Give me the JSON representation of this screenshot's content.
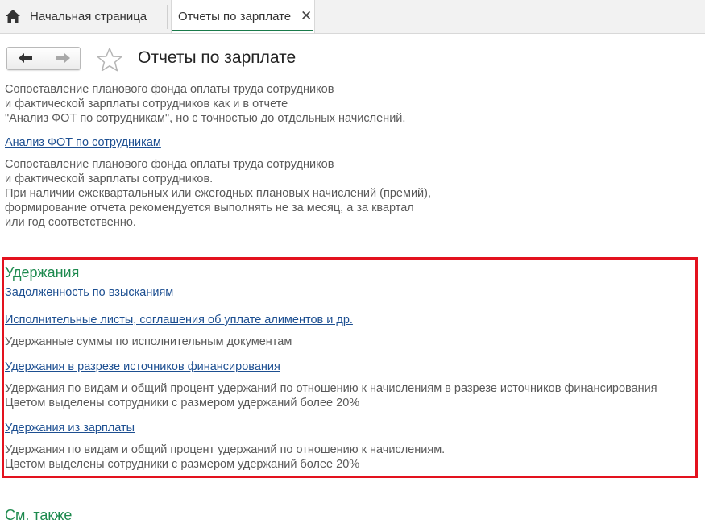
{
  "tabs": {
    "home_label": "Начальная страница",
    "active_label": "Отчеты по зарплате",
    "close_glyph": "✕"
  },
  "header": {
    "title": "Отчеты по зарплате"
  },
  "top_section": {
    "cut_line_1": "Сопоставление планового фонда оплаты труда сотрудников",
    "line_2": "и фактической зарплаты сотрудников как и в отчете",
    "line_3": "\"Анализ ФОТ по сотрудникам\", но с точностью до отдельных начислений.",
    "link_fot": "Анализ ФОТ по сотрудникам",
    "fot_desc": [
      "Сопоставление планового фонда оплаты труда сотрудников",
      "и фактической зарплаты сотрудников.",
      "При наличии ежеквартальных или ежегодных плановых начислений (премий),",
      "формирование отчета рекомендуется выполнять не за месяц, а за квартал",
      "или год соответственно."
    ]
  },
  "withholdings": {
    "title": "Удержания",
    "link_debt": "Задолженность по взысканиям",
    "link_writs": "Исполнительные листы, соглашения об уплате алиментов и др.",
    "writs_desc": "Удержанные суммы по исполнительным документам",
    "link_sources": "Удержания в разрезе источников финансирования",
    "sources_desc": [
      "Удержания по видам и общий процент удержаний по отношению к начислениям в разрезе источников финансирования",
      "Цветом выделены сотрудники с размером удержаний более 20%"
    ],
    "link_salary": "Удержания из зарплаты",
    "salary_desc": [
      "Удержания по видам и общий процент удержаний по отношению к начислениям.",
      "Цветом выделены сотрудники с размером удержаний более 20%"
    ]
  },
  "see_also": {
    "title": "См. также"
  },
  "colors": {
    "section_title": "#1d8a4e",
    "link": "#1d4f91",
    "highlight_border": "#e3121e",
    "tab_underline": "#1a7a4a"
  },
  "icons": {
    "home": "home-icon",
    "back": "arrow-left-icon",
    "forward": "arrow-right-icon",
    "favorite": "star-icon",
    "close": "close-icon"
  }
}
